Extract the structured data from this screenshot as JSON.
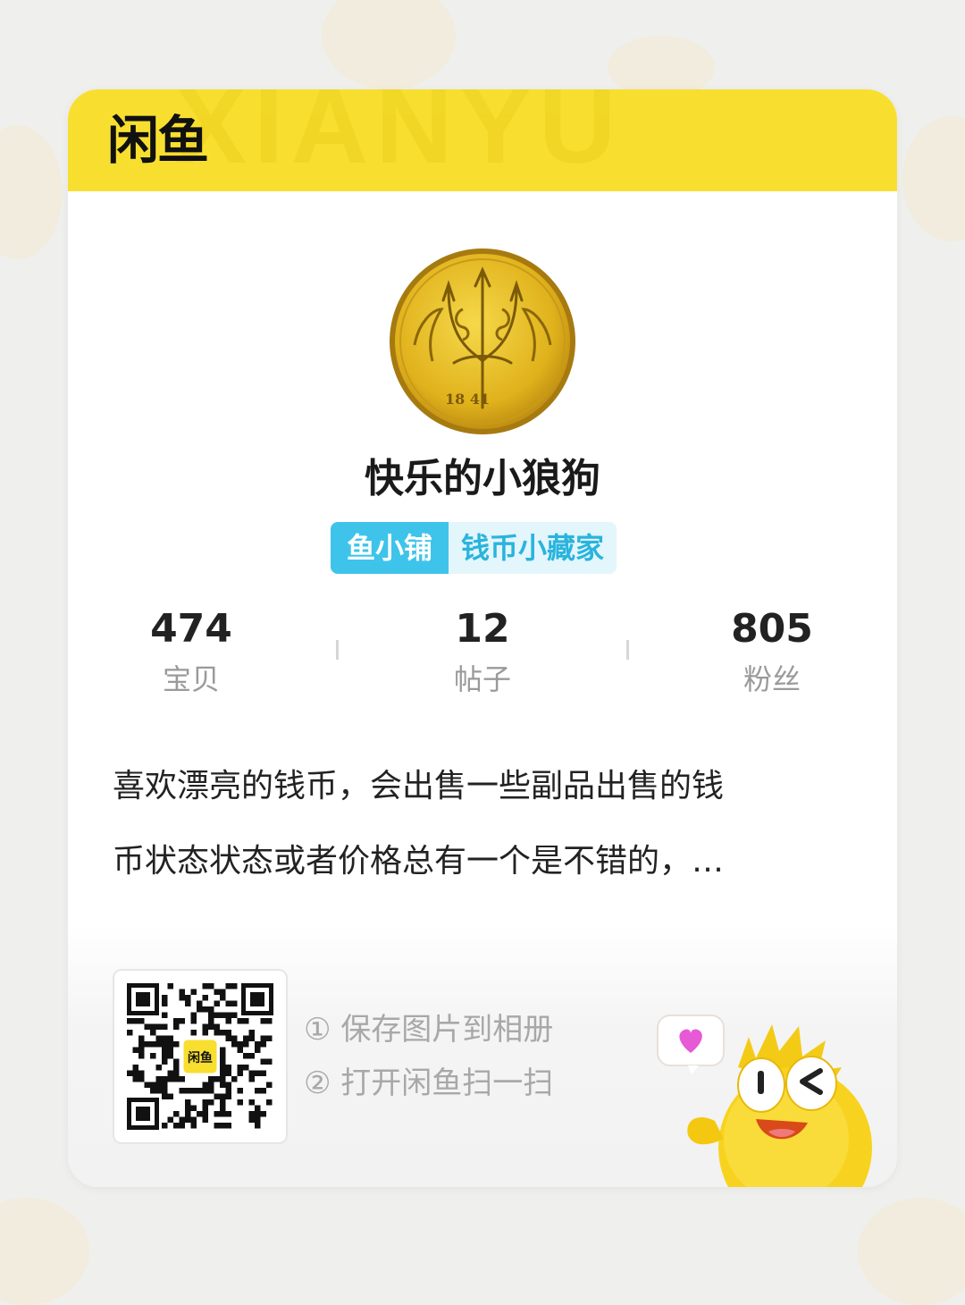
{
  "brand": {
    "logo_text": "闲鱼",
    "watermark": "XIANYU",
    "header_color": "#f8df2f"
  },
  "profile": {
    "avatar": "gold-coin-trident-1841",
    "coin_year": "18  41",
    "nickname": "快乐的小狼狗",
    "shop_tag": "鱼小铺",
    "title_tag": "钱币小藏家"
  },
  "stats": [
    {
      "value": "474",
      "label": "宝贝"
    },
    {
      "value": "12",
      "label": "帖子"
    },
    {
      "value": "805",
      "label": "粉丝"
    }
  ],
  "bio": {
    "line1": "喜欢漂亮的钱币，会出售一些副品出售的钱",
    "line2": "币状态状态或者价格总有一个是不错的，…"
  },
  "qr": {
    "center_logo": "闲鱼",
    "step1": "① 保存图片到相册",
    "step2": "② 打开闲鱼扫一扫"
  },
  "colors": {
    "accent_yellow": "#f8df2f",
    "tag_blue": "#3ec4ea",
    "tag_light": "#e3f6fc",
    "coin_gold": "#e0b21c"
  }
}
